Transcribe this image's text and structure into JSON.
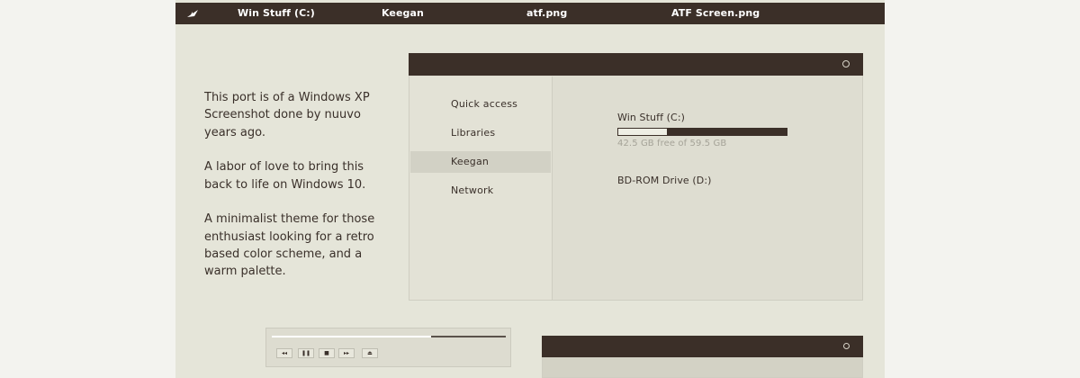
{
  "taskbar": {
    "tasks": [
      "Win Stuff (C:)",
      "Keegan",
      "atf.png",
      "ATF Screen.png"
    ]
  },
  "intro": {
    "paragraphs": [
      "This port is of a Windows XP Screenshot done by nuuvo years ago.",
      "A labor of love to bring this back to life on Windows 10.",
      "A minimalist theme for those enthusiast looking for a retro based color scheme, and a warm palette."
    ]
  },
  "explorer": {
    "nav_items": [
      "Quick access",
      "Libraries",
      "Keegan",
      "Network"
    ],
    "active_nav": "Keegan",
    "drives": [
      {
        "name": "Win Stuff (C:)",
        "free_text": "42.5 GB free of 59.5 GB",
        "free_fraction": 0.29
      },
      {
        "name": "BD-ROM Drive (D:)"
      }
    ]
  },
  "player": {
    "progress_fraction": 0.68,
    "controls": [
      "prev-icon",
      "pause-icon",
      "stop-icon",
      "next-icon",
      "eject-icon"
    ]
  },
  "colors": {
    "titlebar": "#3b2f28",
    "background": "#e5e5d9",
    "accent_light": "#eeeee4"
  }
}
